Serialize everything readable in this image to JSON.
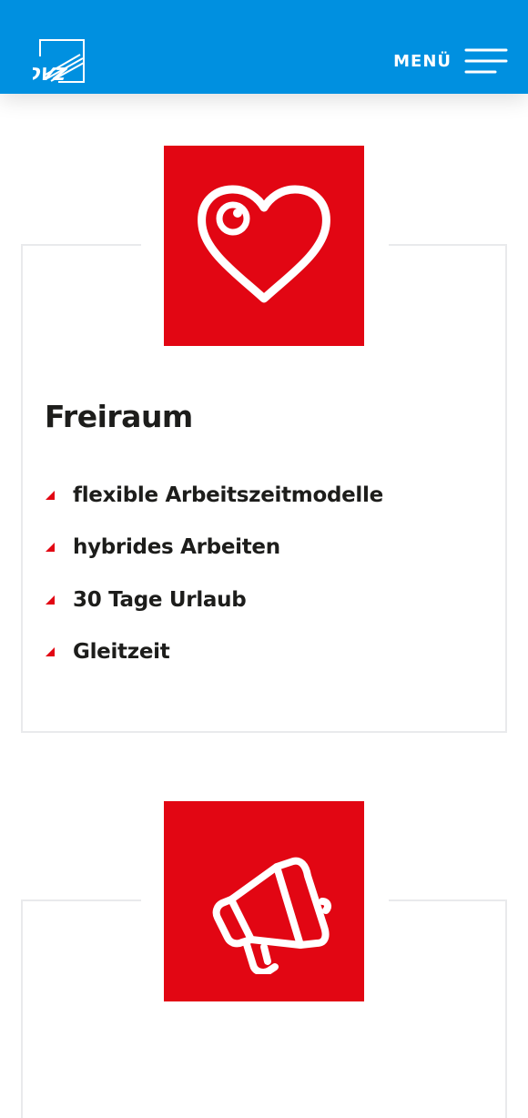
{
  "header": {
    "logo_text": "DVZ",
    "menu_label": "MENÜ",
    "background_color": "#0090e0"
  },
  "cards": [
    {
      "icon": "heart-icon",
      "title": "Freiraum",
      "items": [
        "flexible Arbeitszeitmodelle",
        "hybrides Arbeiten",
        "30 Tage Urlaub",
        "Gleitzeit"
      ]
    },
    {
      "icon": "megaphone-icon"
    }
  ],
  "colors": {
    "accent": "#e20613",
    "text": "#1d1d1b",
    "card_border": "#e9eaec"
  }
}
